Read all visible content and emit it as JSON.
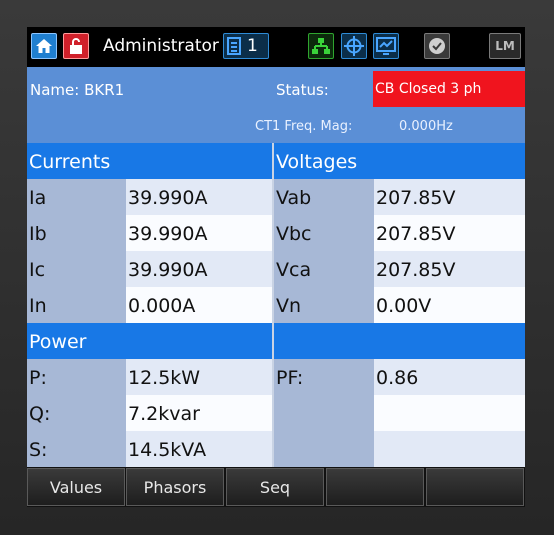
{
  "topbar": {
    "user": "Administrator",
    "doc_count": "1",
    "lm_label": "LM"
  },
  "info": {
    "name": "Name: BKR1",
    "status_label": "Status:",
    "status_value": "CB Closed 3 ph",
    "freq_label": "CT1 Freq. Mag:",
    "freq_value": "0.000Hz"
  },
  "sections": {
    "currents": "Currents",
    "voltages": "Voltages",
    "power": "Power"
  },
  "currents": [
    {
      "label": "Ia",
      "value": "39.990A"
    },
    {
      "label": "Ib",
      "value": "39.990A"
    },
    {
      "label": "Ic",
      "value": "39.990A"
    },
    {
      "label": "In",
      "value": "0.000A"
    }
  ],
  "voltages": [
    {
      "label": "Vab",
      "value": "207.85V"
    },
    {
      "label": "Vbc",
      "value": "207.85V"
    },
    {
      "label": "Vca",
      "value": "207.85V"
    },
    {
      "label": "Vn",
      "value": "0.00V"
    }
  ],
  "power": [
    {
      "label": "P:",
      "value": "12.5kW"
    },
    {
      "label": "Q:",
      "value": "7.2kvar"
    },
    {
      "label": "S:",
      "value": "14.5kVA"
    }
  ],
  "pf": {
    "label": "PF:",
    "value": "0.86"
  },
  "tabs": [
    "Values",
    "Phasors",
    "Seq",
    "",
    ""
  ],
  "colors": {
    "header_bg": "#5b8fd6",
    "section_bg": "#1878e6",
    "status_alarm": "#f0141e"
  }
}
